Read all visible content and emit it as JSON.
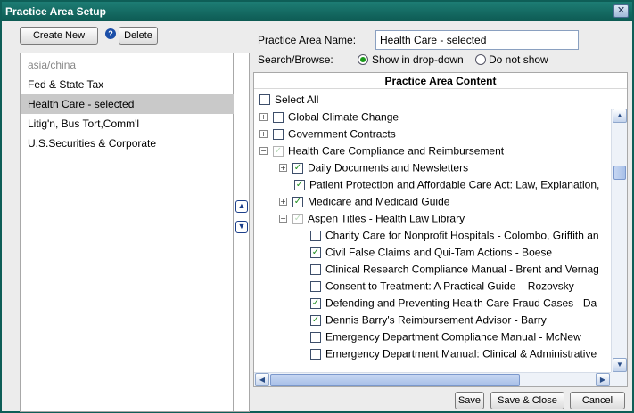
{
  "window": {
    "title": "Practice Area Setup"
  },
  "toolbar": {
    "create_new": "Create New",
    "delete": "Delete",
    "help_glyph": "?"
  },
  "practice_areas": [
    {
      "label": "asia/china",
      "dimmed": true
    },
    {
      "label": "Fed & State Tax"
    },
    {
      "label": "Health Care - selected",
      "selected": true
    },
    {
      "label": "Litig'n, Bus Tort,Comm'l"
    },
    {
      "label": "U.S.Securities & Corporate"
    }
  ],
  "form": {
    "name_label": "Practice Area Name:",
    "name_value": "Health Care - selected",
    "search_label": "Search/Browse:",
    "option_show": "Show in drop-down",
    "option_hide": "Do not show",
    "selected_option": "Show in drop-down"
  },
  "content": {
    "header": "Practice Area Content",
    "select_all": "Select All",
    "tree": [
      {
        "label": "Global Climate Change",
        "indent": 0,
        "expander": "plus",
        "checked": false
      },
      {
        "label": "Government Contracts",
        "indent": 0,
        "expander": "plus",
        "checked": false
      },
      {
        "label": "Health Care Compliance and Reimbursement",
        "indent": 0,
        "expander": "minus",
        "checked": "partial"
      },
      {
        "label": "Daily Documents and Newsletters",
        "indent": 1,
        "expander": "plus",
        "checked": true
      },
      {
        "label": "Patient Protection and Affordable Care Act: Law, Explanation,",
        "indent": 1,
        "expander": "none",
        "checked": true
      },
      {
        "label": "Medicare and Medicaid Guide",
        "indent": 1,
        "expander": "plus",
        "checked": true
      },
      {
        "label": "Aspen Titles - Health Law Library",
        "indent": 1,
        "expander": "minus",
        "checked": "partial"
      },
      {
        "label": "Charity Care for Nonprofit Hospitals - Colombo, Griffith an",
        "indent": 2,
        "expander": "none",
        "checked": false
      },
      {
        "label": "Civil False Claims and Qui-Tam Actions - Boese",
        "indent": 2,
        "expander": "none",
        "checked": true
      },
      {
        "label": "Clinical Research Compliance Manual - Brent and Vernag",
        "indent": 2,
        "expander": "none",
        "checked": false
      },
      {
        "label": "Consent to Treatment: A Practical Guide – Rozovsky",
        "indent": 2,
        "expander": "none",
        "checked": false
      },
      {
        "label": "Defending and Preventing Health Care Fraud Cases - Da",
        "indent": 2,
        "expander": "none",
        "checked": true
      },
      {
        "label": "Dennis Barry's Reimbursement Advisor - Barry",
        "indent": 2,
        "expander": "none",
        "checked": true
      },
      {
        "label": "Emergency Department Compliance Manual - McNew",
        "indent": 2,
        "expander": "none",
        "checked": false
      },
      {
        "label": "Emergency Department Manual: Clinical & Administrative",
        "indent": 2,
        "expander": "none",
        "checked": false
      }
    ]
  },
  "footer": {
    "save": "Save",
    "save_close": "Save & Close",
    "cancel": "Cancel"
  },
  "icons": {
    "close": "close-icon",
    "help": "help-icon",
    "move_up": "arrow-up-icon",
    "move_down": "arrow-down-icon"
  },
  "colors": {
    "titlebar": "#0d5a53",
    "selection": "#c9c9c9",
    "check": "#1e8f1e"
  }
}
